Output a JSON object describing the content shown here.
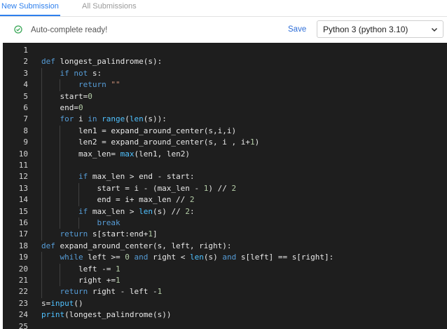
{
  "tabs": [
    {
      "label": "New Submission",
      "active": true
    },
    {
      "label": "All Submissions",
      "active": false
    }
  ],
  "toolbar": {
    "status_text": "Auto-complete ready!",
    "status_icon": "check-circle-icon",
    "save_label": "Save",
    "language": "Python 3 (python 3.10)"
  },
  "colors": {
    "accent": "#2f80ed",
    "editor_bg": "#1e1e1e",
    "keyword": "#569cd6",
    "number": "#b5cea8",
    "string": "#ce9178",
    "function": "#dcdcaa"
  },
  "editor": {
    "lines": [
      [],
      [
        [
          "def",
          "kw"
        ],
        [
          " longest_palindrome(s):",
          ""
        ]
      ],
      [
        [
          "    ",
          ""
        ],
        [
          "if",
          "kw"
        ],
        [
          " ",
          ""
        ],
        [
          "not",
          "kw"
        ],
        [
          " s:",
          ""
        ]
      ],
      [
        [
          "        ",
          ""
        ],
        [
          "return",
          "kw"
        ],
        [
          " ",
          ""
        ],
        [
          "\"\"",
          "str"
        ]
      ],
      [
        [
          "    start=",
          ""
        ],
        [
          "0",
          "num"
        ]
      ],
      [
        [
          "    end=",
          ""
        ],
        [
          "0",
          "num"
        ]
      ],
      [
        [
          "    ",
          ""
        ],
        [
          "for",
          "kw"
        ],
        [
          " i ",
          ""
        ],
        [
          "in",
          "kw"
        ],
        [
          " ",
          ""
        ],
        [
          "range",
          "bi"
        ],
        [
          "(",
          ""
        ],
        [
          "len",
          "bi"
        ],
        [
          "(s)):",
          ""
        ]
      ],
      [
        [
          "        len1 = expand_around_center(s,i,i)",
          ""
        ]
      ],
      [
        [
          "        len2 = expand_around_center(s, i , i+",
          ""
        ],
        [
          "1",
          "num"
        ],
        [
          ")",
          ""
        ]
      ],
      [
        [
          "        max_len= ",
          ""
        ],
        [
          "max",
          "bi"
        ],
        [
          "(len1, len2)",
          ""
        ]
      ],
      [],
      [
        [
          "        ",
          ""
        ],
        [
          "if",
          "kw"
        ],
        [
          " max_len > end - start:",
          ""
        ]
      ],
      [
        [
          "            start = i - (max_len - ",
          ""
        ],
        [
          "1",
          "num"
        ],
        [
          ") // ",
          ""
        ],
        [
          "2",
          "num"
        ]
      ],
      [
        [
          "            end = i+ max_len // ",
          ""
        ],
        [
          "2",
          "num"
        ]
      ],
      [
        [
          "        ",
          ""
        ],
        [
          "if",
          "kw"
        ],
        [
          " max_len > ",
          ""
        ],
        [
          "len",
          "bi"
        ],
        [
          "(s) // ",
          ""
        ],
        [
          "2",
          "num"
        ],
        [
          ":",
          ""
        ]
      ],
      [
        [
          "            ",
          ""
        ],
        [
          "break",
          "kw"
        ]
      ],
      [
        [
          "    ",
          ""
        ],
        [
          "return",
          "kw"
        ],
        [
          " s[start:end+",
          ""
        ],
        [
          "1",
          "num"
        ],
        [
          "]",
          ""
        ]
      ],
      [
        [
          "def",
          "kw"
        ],
        [
          " expand_around_center(s, left, right):",
          ""
        ]
      ],
      [
        [
          "    ",
          ""
        ],
        [
          "while",
          "kw"
        ],
        [
          " left >= ",
          ""
        ],
        [
          "0",
          "num"
        ],
        [
          " ",
          ""
        ],
        [
          "and",
          "kw"
        ],
        [
          " right < ",
          ""
        ],
        [
          "len",
          "bi"
        ],
        [
          "(s) ",
          ""
        ],
        [
          "and",
          "kw"
        ],
        [
          " s[left] == s[right]:",
          ""
        ]
      ],
      [
        [
          "        left -= ",
          ""
        ],
        [
          "1",
          "num"
        ]
      ],
      [
        [
          "        right +=",
          ""
        ],
        [
          "1",
          "num"
        ]
      ],
      [
        [
          "    ",
          ""
        ],
        [
          "return",
          "kw"
        ],
        [
          " right - left -",
          ""
        ],
        [
          "1",
          "num"
        ]
      ],
      [
        [
          "s=",
          ""
        ],
        [
          "input",
          "bi"
        ],
        [
          "()",
          ""
        ]
      ],
      [
        [
          "print",
          "bi"
        ],
        [
          "(longest_palindrome(s))",
          ""
        ]
      ],
      []
    ]
  }
}
